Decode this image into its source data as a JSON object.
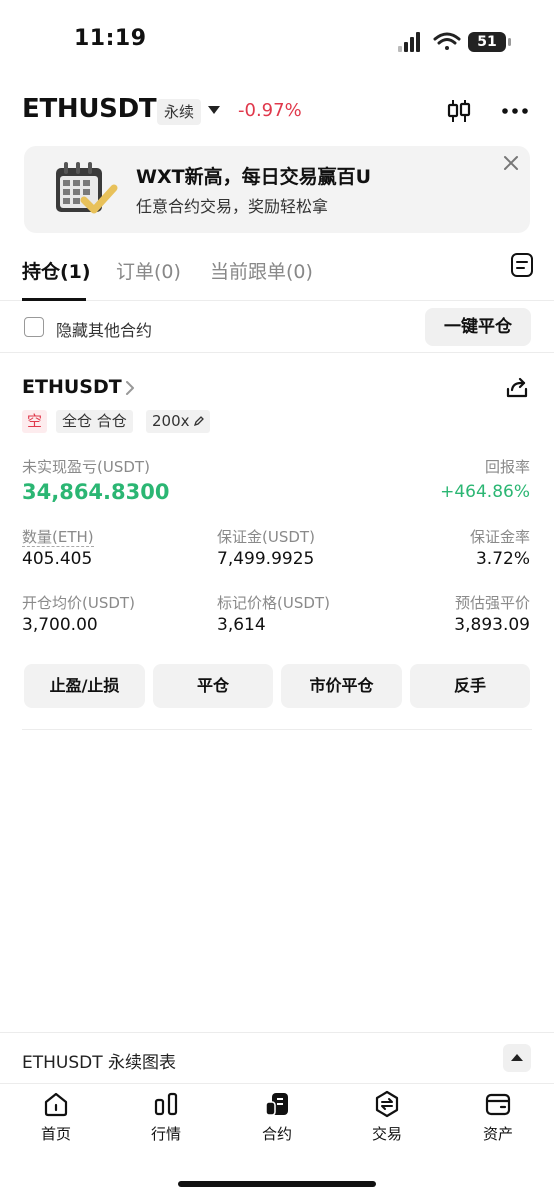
{
  "status_bar": {
    "time": "11:19",
    "battery": "51"
  },
  "header": {
    "symbol": "ETHUSDT",
    "contract_type": "永续",
    "change": "-0.97%"
  },
  "banner": {
    "title": "WXT新高，每日交易赢百U",
    "subtitle": "任意合约交易，奖励轻松拿"
  },
  "tabs": [
    {
      "label": "持仓(1)"
    },
    {
      "label": "订单(0)"
    },
    {
      "label": "当前跟单(0)"
    }
  ],
  "filter": {
    "hide_label": "隐藏其他合约",
    "close_all": "一键平仓"
  },
  "position": {
    "symbol": "ETHUSDT",
    "side": "空",
    "margin_mode": "全仓 合仓",
    "leverage": "200x",
    "pnl_label": "未实现盈亏(USDT)",
    "pnl_value": "34,864.8300",
    "roe_label": "回报率",
    "roe_value": "+464.86%",
    "qty_label": "数量(ETH)",
    "qty_value": "405.405",
    "margin_label": "保证金(USDT)",
    "margin_value": "7,499.9925",
    "margin_ratio_label": "保证金率",
    "margin_ratio_value": "3.72%",
    "entry_label": "开仓均价(USDT)",
    "entry_value": "3,700.00",
    "mark_label": "标记价格(USDT)",
    "mark_value": "3,614",
    "liq_label": "预估强平价",
    "liq_value": "3,893.09"
  },
  "actions": [
    {
      "label": "止盈/止损"
    },
    {
      "label": "平仓"
    },
    {
      "label": "市价平仓"
    },
    {
      "label": "反手"
    }
  ],
  "chart_bar": {
    "label": "ETHUSDT 永续图表"
  },
  "nav": [
    {
      "label": "首页",
      "icon": "home-icon"
    },
    {
      "label": "行情",
      "icon": "market-icon"
    },
    {
      "label": "合约",
      "icon": "futures-icon"
    },
    {
      "label": "交易",
      "icon": "trade-icon"
    },
    {
      "label": "资产",
      "icon": "wallet-icon"
    }
  ],
  "colors": {
    "up": "#2bb673",
    "down": "#e0384b"
  }
}
